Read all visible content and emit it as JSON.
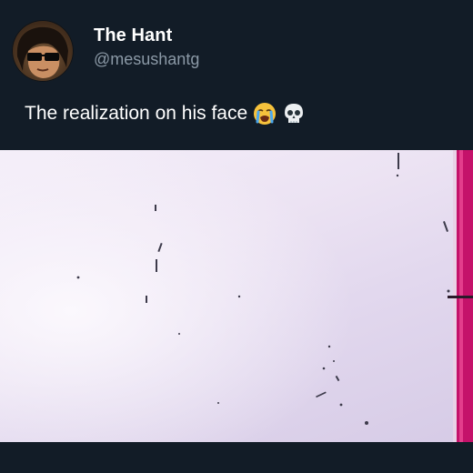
{
  "tweet": {
    "display_name": "The Hant",
    "handle": "@mesushantg",
    "text": "The realization on his face",
    "emojis": [
      "loudly-crying-face",
      "skull"
    ]
  },
  "colors": {
    "background": "#121c27",
    "name_text": "#ffffff",
    "handle_text": "#8b99a6",
    "media_sky": "#ece3f3",
    "media_edge": "#c4126a"
  }
}
